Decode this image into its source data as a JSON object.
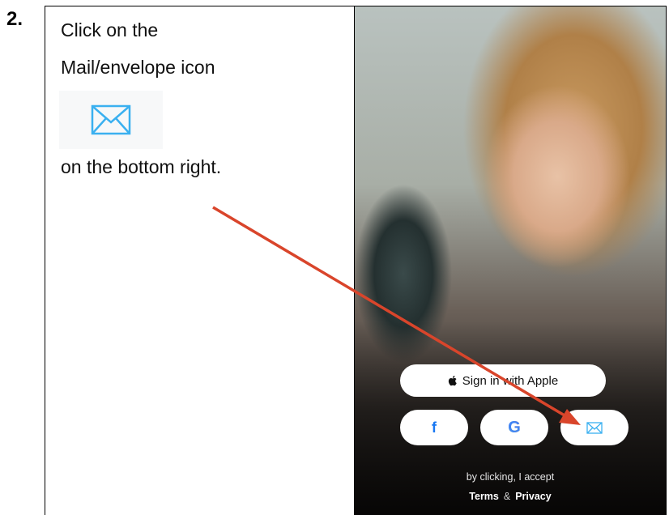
{
  "step": {
    "number": "2."
  },
  "instructions": {
    "line1": "Click on the",
    "line2": "Mail/envelope icon",
    "line3": "on the bottom right."
  },
  "phone": {
    "apple_button_label": "Sign in with Apple",
    "facebook_label": "f",
    "google_label": "G",
    "accept_text": "by clicking, I accept",
    "terms_label": "Terms",
    "ampersand": "&",
    "privacy_label": "Privacy"
  },
  "icons": [
    "envelope-icon",
    "apple-icon",
    "facebook-icon",
    "google-icon",
    "mail-icon"
  ],
  "colors": {
    "envelope_blue": "#3ab0f0",
    "arrow_red": "#d9452b",
    "facebook_blue": "#1877f2"
  }
}
